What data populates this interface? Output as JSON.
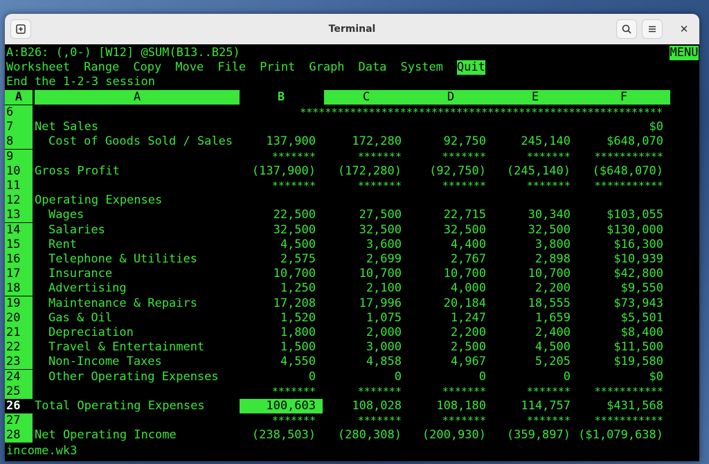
{
  "window": {
    "title": "Terminal"
  },
  "terminal": {
    "status_line": "A:B26: (,0-) [W12] @SUM(B13..B25)",
    "mode_indicator": "MENU",
    "menu": [
      "Worksheet",
      "Range",
      "Copy",
      "Move",
      "File",
      "Print",
      "Graph",
      "Data",
      "System",
      "Quit"
    ],
    "selected_menu": "Quit",
    "menu_description": "End the 1-2-3 session",
    "sheet_letter": "A",
    "columns": [
      "A",
      "B",
      "C",
      "D",
      "E",
      "F"
    ],
    "filename": "income.wk3"
  },
  "rows": [
    {
      "n": "6",
      "label": "",
      "indent": false,
      "cells": [
        "",
        "",
        "",
        "",
        ""
      ],
      "stars_full": true
    },
    {
      "n": "7",
      "label": "Net Sales",
      "indent": false,
      "cells": [
        "",
        "",
        "",
        "",
        "$0"
      ]
    },
    {
      "n": "8",
      "label": "Cost of Goods Sold / Sales",
      "indent": true,
      "cells": [
        "137,900",
        "172,280",
        "92,750",
        "245,140",
        "$648,070"
      ]
    },
    {
      "n": "9",
      "label": "",
      "indent": false,
      "cells": [
        "*******",
        "*******",
        "*******",
        "*******",
        "***********"
      ]
    },
    {
      "n": "10",
      "label": "Gross Profit",
      "indent": false,
      "cells": [
        "(137,900)",
        "(172,280)",
        "(92,750)",
        "(245,140)",
        "($648,070)"
      ]
    },
    {
      "n": "11",
      "label": "",
      "indent": false,
      "cells": [
        "*******",
        "*******",
        "*******",
        "*******",
        "***********"
      ]
    },
    {
      "n": "12",
      "label": "Operating Expenses",
      "indent": false,
      "cells": [
        "",
        "",
        "",
        "",
        ""
      ]
    },
    {
      "n": "13",
      "label": "Wages",
      "indent": true,
      "cells": [
        "22,500",
        "27,500",
        "22,715",
        "30,340",
        "$103,055"
      ]
    },
    {
      "n": "14",
      "label": "Salaries",
      "indent": true,
      "cells": [
        "32,500",
        "32,500",
        "32,500",
        "32,500",
        "$130,000"
      ]
    },
    {
      "n": "15",
      "label": "Rent",
      "indent": true,
      "cells": [
        "4,500",
        "3,600",
        "4,400",
        "3,800",
        "$16,300"
      ]
    },
    {
      "n": "16",
      "label": "Telephone & Utilities",
      "indent": true,
      "cells": [
        "2,575",
        "2,699",
        "2,767",
        "2,898",
        "$10,939"
      ]
    },
    {
      "n": "17",
      "label": "Insurance",
      "indent": true,
      "cells": [
        "10,700",
        "10,700",
        "10,700",
        "10,700",
        "$42,800"
      ]
    },
    {
      "n": "18",
      "label": "Advertising",
      "indent": true,
      "cells": [
        "1,250",
        "2,100",
        "4,000",
        "2,200",
        "$9,550"
      ]
    },
    {
      "n": "19",
      "label": "Maintenance & Repairs",
      "indent": true,
      "cells": [
        "17,208",
        "17,996",
        "20,184",
        "18,555",
        "$73,943"
      ]
    },
    {
      "n": "20",
      "label": "Gas & Oil",
      "indent": true,
      "cells": [
        "1,520",
        "1,075",
        "1,247",
        "1,659",
        "$5,501"
      ]
    },
    {
      "n": "21",
      "label": "Depreciation",
      "indent": true,
      "cells": [
        "1,800",
        "2,000",
        "2,200",
        "2,400",
        "$8,400"
      ]
    },
    {
      "n": "22",
      "label": "Travel & Entertainment",
      "indent": true,
      "cells": [
        "1,500",
        "3,000",
        "2,500",
        "4,500",
        "$11,500"
      ]
    },
    {
      "n": "23",
      "label": "Non-Income Taxes",
      "indent": true,
      "cells": [
        "4,550",
        "4,858",
        "4,967",
        "5,205",
        "$19,580"
      ]
    },
    {
      "n": "24",
      "label": "Other Operating Expenses",
      "indent": true,
      "cells": [
        "0",
        "0",
        "0",
        "0",
        "$0"
      ]
    },
    {
      "n": "25",
      "label": "",
      "indent": false,
      "cells": [
        "*******",
        "*******",
        "*******",
        "*******",
        "***********"
      ]
    },
    {
      "n": "26",
      "label": "Total Operating Expenses",
      "indent": false,
      "cells": [
        "100,603",
        "108,028",
        "108,180",
        "114,757",
        "$431,568"
      ],
      "current": true
    },
    {
      "n": "27",
      "label": "",
      "indent": false,
      "cells": [
        "*******",
        "*******",
        "*******",
        "*******",
        "***********"
      ]
    },
    {
      "n": "28",
      "label": "Net Operating Income",
      "indent": false,
      "cells": [
        "(238,503)",
        "(280,308)",
        "(200,930)",
        "(359,897)",
        "($1,079,638)"
      ]
    }
  ],
  "stars_line": "**********************************************************",
  "colors": {
    "terminal_green": "#39e639",
    "terminal_bg": "#000000",
    "titlebar": "#ebebeb"
  }
}
